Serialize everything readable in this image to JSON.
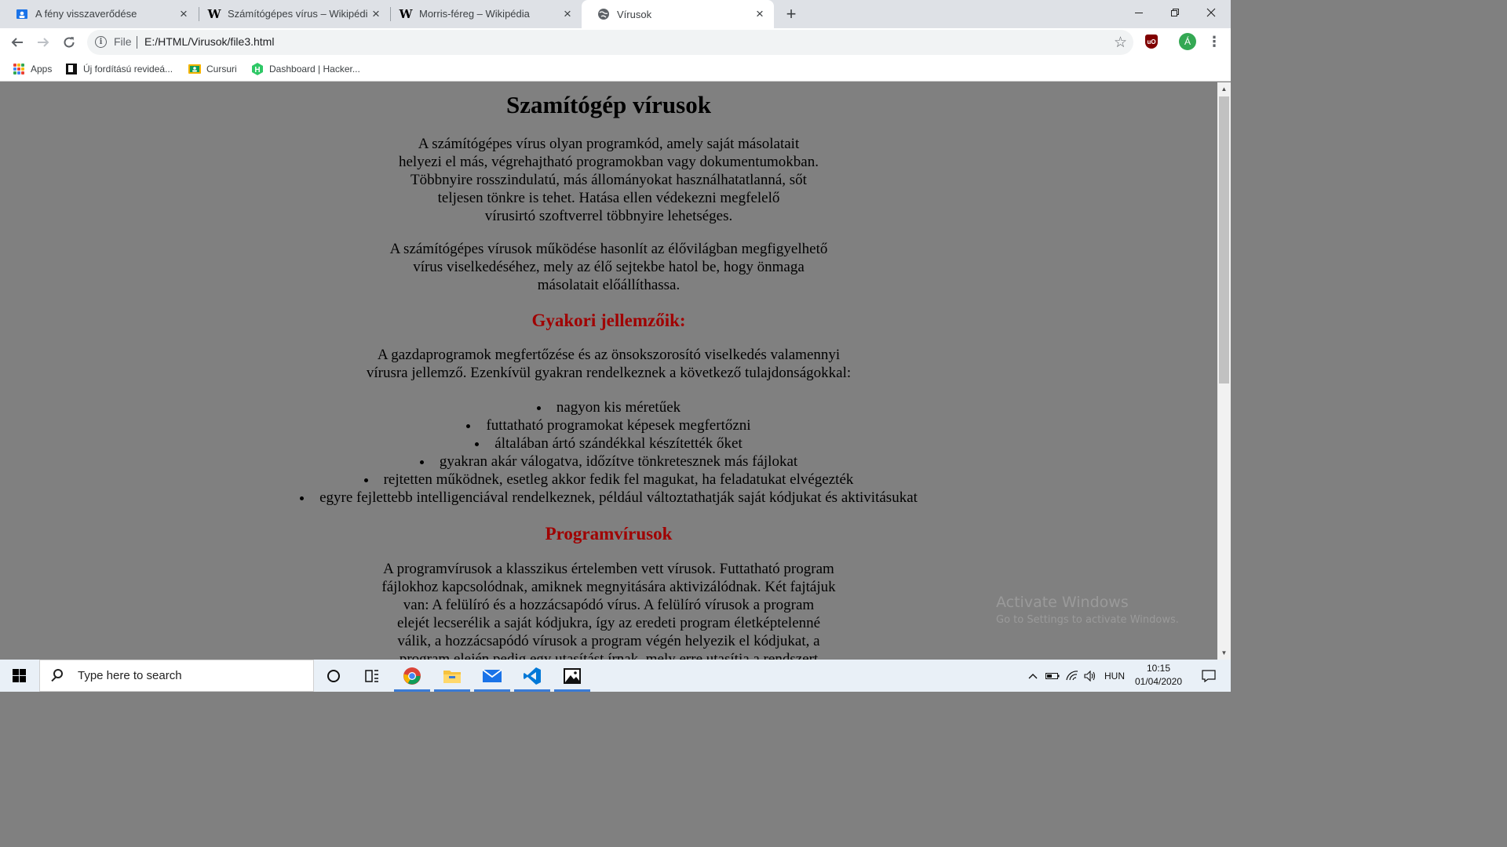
{
  "browser": {
    "tabs": [
      {
        "label": "A fény visszaverődése",
        "favicon": "classroom-icon",
        "active": false
      },
      {
        "label": "Számítógépes vírus – Wikipédia",
        "favicon": "wikipedia-icon",
        "active": false
      },
      {
        "label": "Morris-féreg – Wikipédia",
        "favicon": "wikipedia-icon",
        "active": false
      },
      {
        "label": "Vírusok",
        "favicon": "globe-icon",
        "active": true
      }
    ],
    "new_tab_symbol": "+",
    "address_scheme": "File",
    "address_url": "E:/HTML/Virusok/file3.html",
    "profile_initial": "Á",
    "ublock_label": "uO",
    "bookmarks": [
      {
        "label": "Apps",
        "icon": "apps-grid-icon"
      },
      {
        "label": "Új fordítású revideá...",
        "icon": "bible-icon"
      },
      {
        "label": "Cursuri",
        "icon": "classroom-icon"
      },
      {
        "label": "Dashboard | Hacker...",
        "icon": "hackerrank-icon"
      }
    ]
  },
  "page": {
    "title": "Szamítógép vírusok",
    "intro_lines": [
      "A számítógépes vírus olyan programkód, amely saját másolatait",
      "helyezi el más, végrehajtható programokban vagy dokumentumokban.",
      "Többnyire rosszindulatú, más állományokat használhatatlanná, sőt",
      "teljesen tönkre is tehet. Hatása ellen védekezni megfelelő",
      "vírusirtó szoftverrel többnyire lehetséges."
    ],
    "analogy_lines": [
      "A számítógépes vírusok működése hasonlít az élővilágban megfigyelhető",
      "vírus viselkedéséhez, mely az élő sejtekbe hatol be, hogy önmaga",
      "másolatait előállíthassa."
    ],
    "section1_heading": "Gyakori jellemzőik:",
    "section1_lines": [
      "A gazdaprogramok megfertőzése és az önsokszorosító viselkedés valamennyi",
      "vírusra jellemző. Ezenkívül gyakran rendelkeznek a következő tulajdonságokkal:"
    ],
    "features": [
      "nagyon kis méretűek",
      "futtatható programokat képesek megfertőzni",
      "általában ártó szándékkal készítették őket",
      "gyakran akár válogatva, időzítve tönkretesznek más fájlokat",
      "rejtetten működnek, esetleg akkor fedik fel magukat, ha feladatukat elvégezték",
      "egyre fejlettebb intelligenciával rendelkeznek, például változtathatják saját kódjukat és aktivitásukat"
    ],
    "section2_heading": "Programvírusok",
    "section2_lines": [
      "A programvírusok a klasszikus értelemben vett vírusok. Futtatható program",
      "fájlokhoz kapcsolódnak, amiknek megnyitására aktivizálódnak. Két fajtájuk",
      "van: A felülíró és a hozzácsapódó vírus. A felülíró vírusok a program",
      "elejét lecserélik a saját kódjukra, így az eredeti program életképtelenné",
      "válik, a hozzácsapódó vírusok a program végén helyezik el kódjukat, a",
      "program elején pedig egy utasítást írnak, mely erre utasítja a rendszert"
    ]
  },
  "watermark": {
    "title": "Activate Windows",
    "subtitle": "Go to Settings to activate Windows."
  },
  "taskbar": {
    "search_placeholder": "Type here to search",
    "language": "HUN",
    "time": "10:15",
    "date": "01/04/2020",
    "pinned": [
      "cortana-icon",
      "task-view-icon",
      "chrome-icon",
      "file-explorer-icon",
      "mail-icon",
      "vscode-icon",
      "photos-icon"
    ]
  },
  "colors": {
    "heading_red": "#a00000",
    "page_background": "#808080",
    "taskbar_background": "#e9f0f7"
  }
}
